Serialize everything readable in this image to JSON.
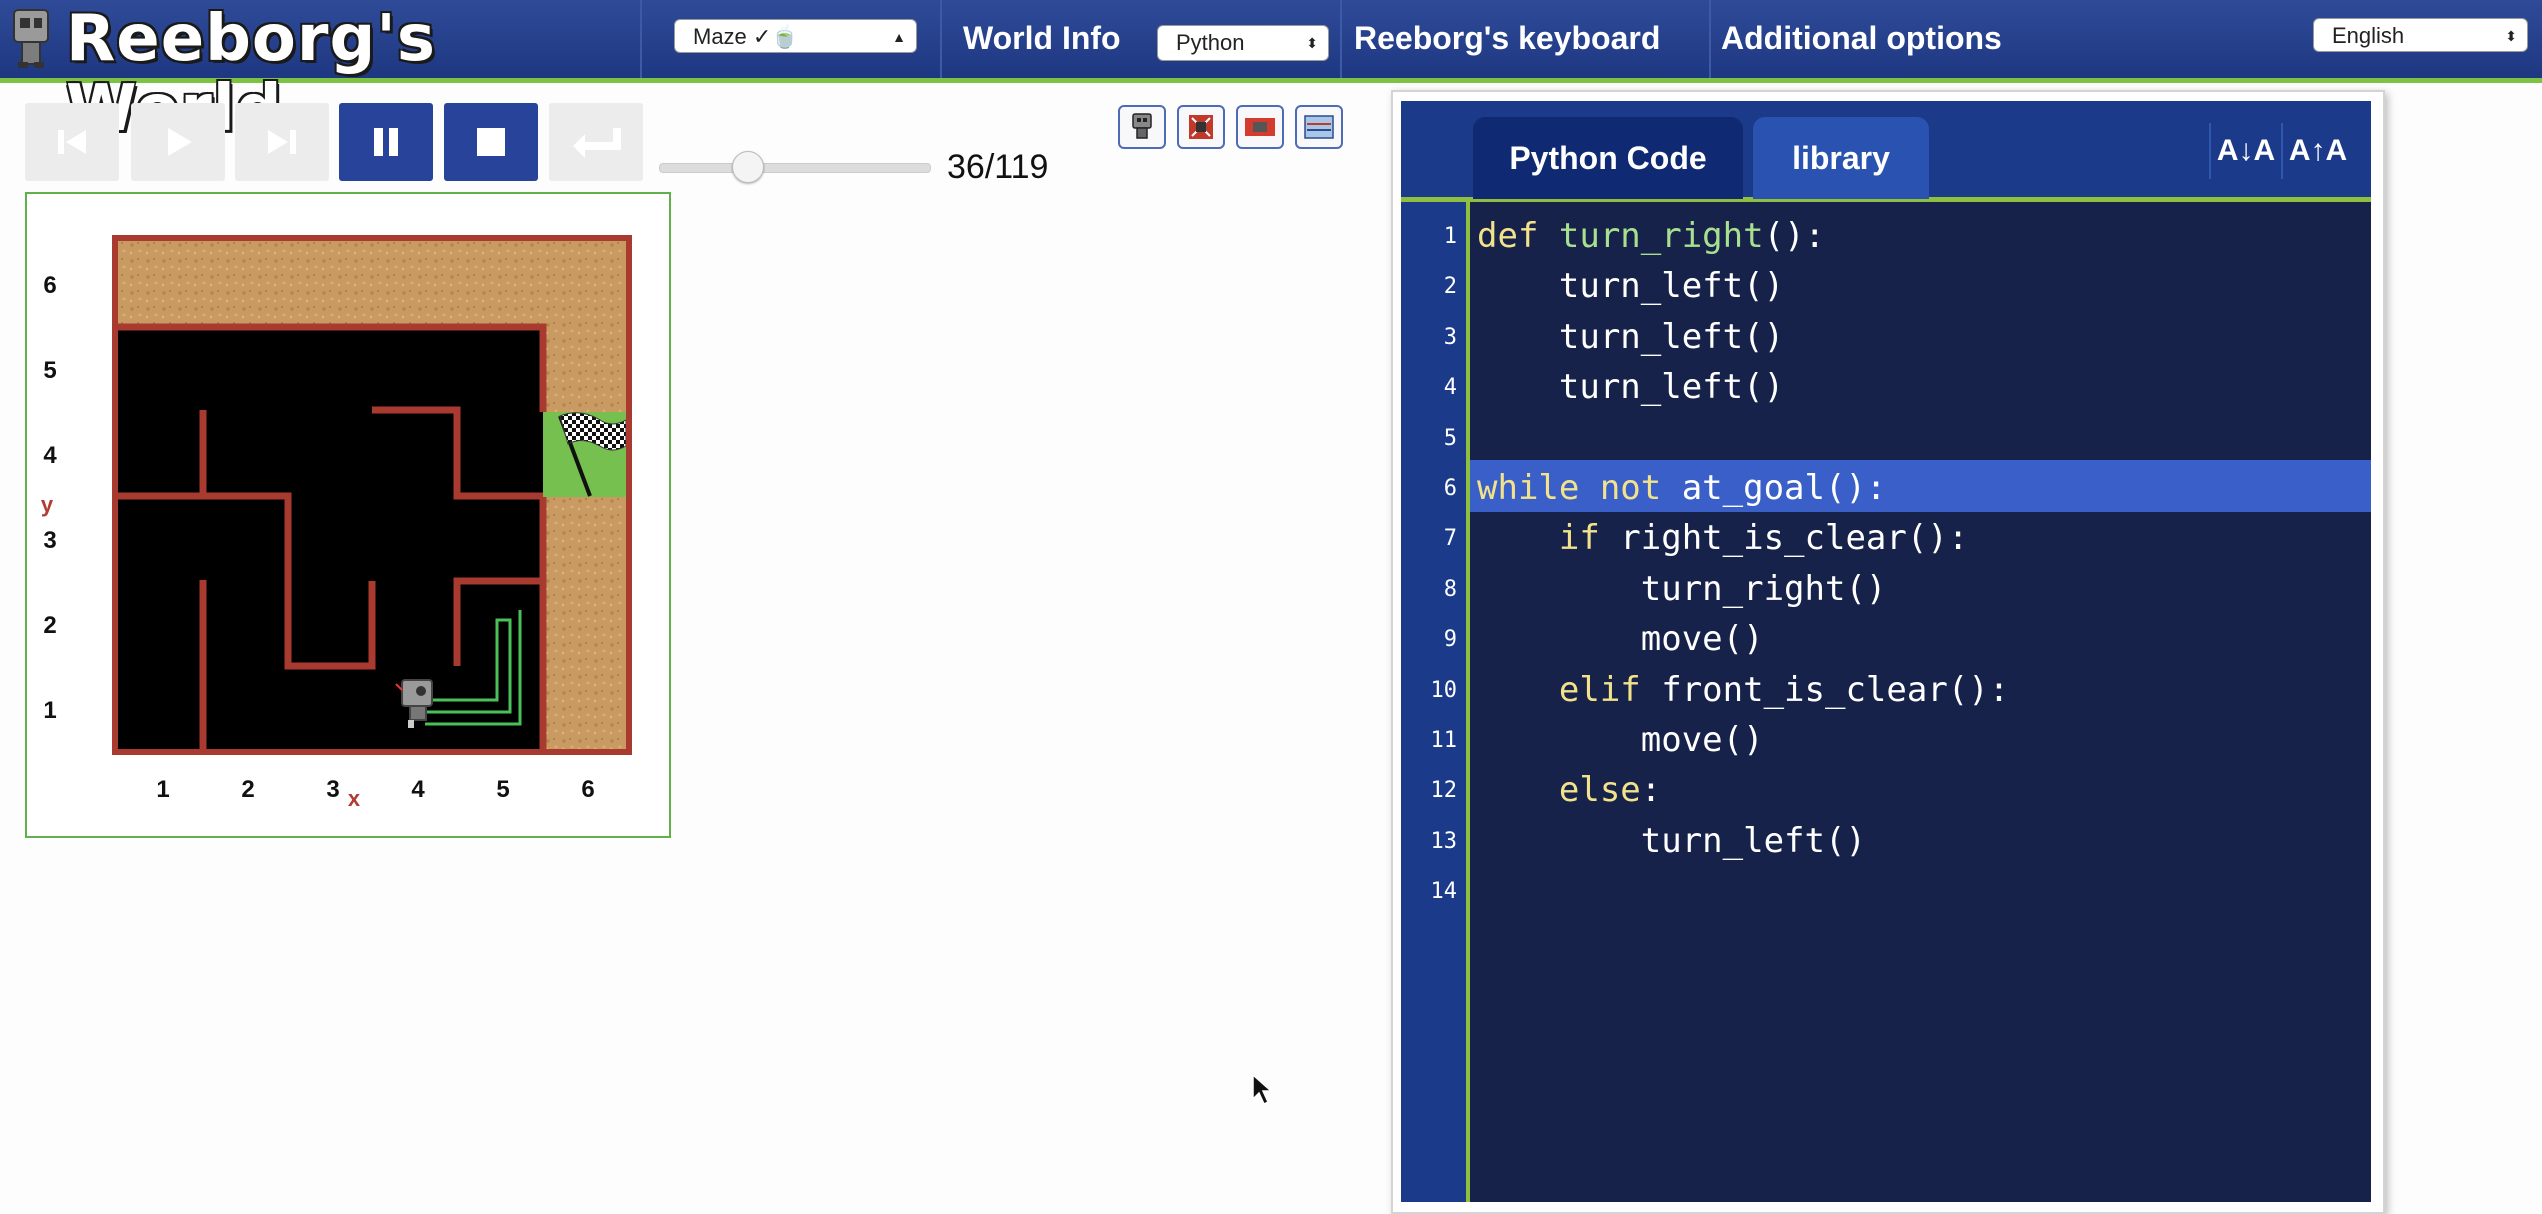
{
  "header": {
    "title": "Reeborg's World",
    "world_select": "Maze ✓🍵",
    "nav_world_info": "World Info",
    "language_select": "Python",
    "nav_keyboard": "Reeborg's keyboard",
    "nav_options": "Additional options",
    "ui_language_select": "English"
  },
  "controls": {
    "step_counter": "36/119",
    "slider_progress": 0.3025
  },
  "world": {
    "y_labels": [
      "6",
      "5",
      "4",
      "3",
      "2",
      "1"
    ],
    "x_labels": [
      "1",
      "2",
      "3",
      "4",
      "5",
      "6"
    ],
    "y_axis": "y",
    "x_axis": "x"
  },
  "editor": {
    "tab_code": "Python Code",
    "tab_library": "library",
    "font_decrease": "A↓A",
    "font_increase": "A↑A",
    "highlighted_line": 6,
    "lines": [
      [
        {
          "t": "def ",
          "c": "kw"
        },
        {
          "t": "turn_right",
          "c": "fn"
        },
        {
          "t": "():",
          "c": ""
        }
      ],
      [
        {
          "t": "    turn_left()",
          "c": ""
        }
      ],
      [
        {
          "t": "    turn_left()",
          "c": ""
        }
      ],
      [
        {
          "t": "    turn_left()",
          "c": ""
        }
      ],
      [],
      [
        {
          "t": "while not ",
          "c": "kw"
        },
        {
          "t": "at_goal():",
          "c": ""
        }
      ],
      [
        {
          "t": "    if ",
          "c": "kw"
        },
        {
          "t": "right_is_clear():",
          "c": ""
        }
      ],
      [
        {
          "t": "        turn_right()",
          "c": ""
        }
      ],
      [
        {
          "t": "        move()",
          "c": ""
        }
      ],
      [
        {
          "t": "    elif ",
          "c": "kw"
        },
        {
          "t": "front_is_clear():",
          "c": ""
        }
      ],
      [
        {
          "t": "        move()",
          "c": ""
        }
      ],
      [
        {
          "t": "    else",
          "c": "kw"
        },
        {
          "t": ":",
          "c": ""
        }
      ],
      [
        {
          "t": "        turn_left()",
          "c": ""
        }
      ],
      []
    ]
  }
}
